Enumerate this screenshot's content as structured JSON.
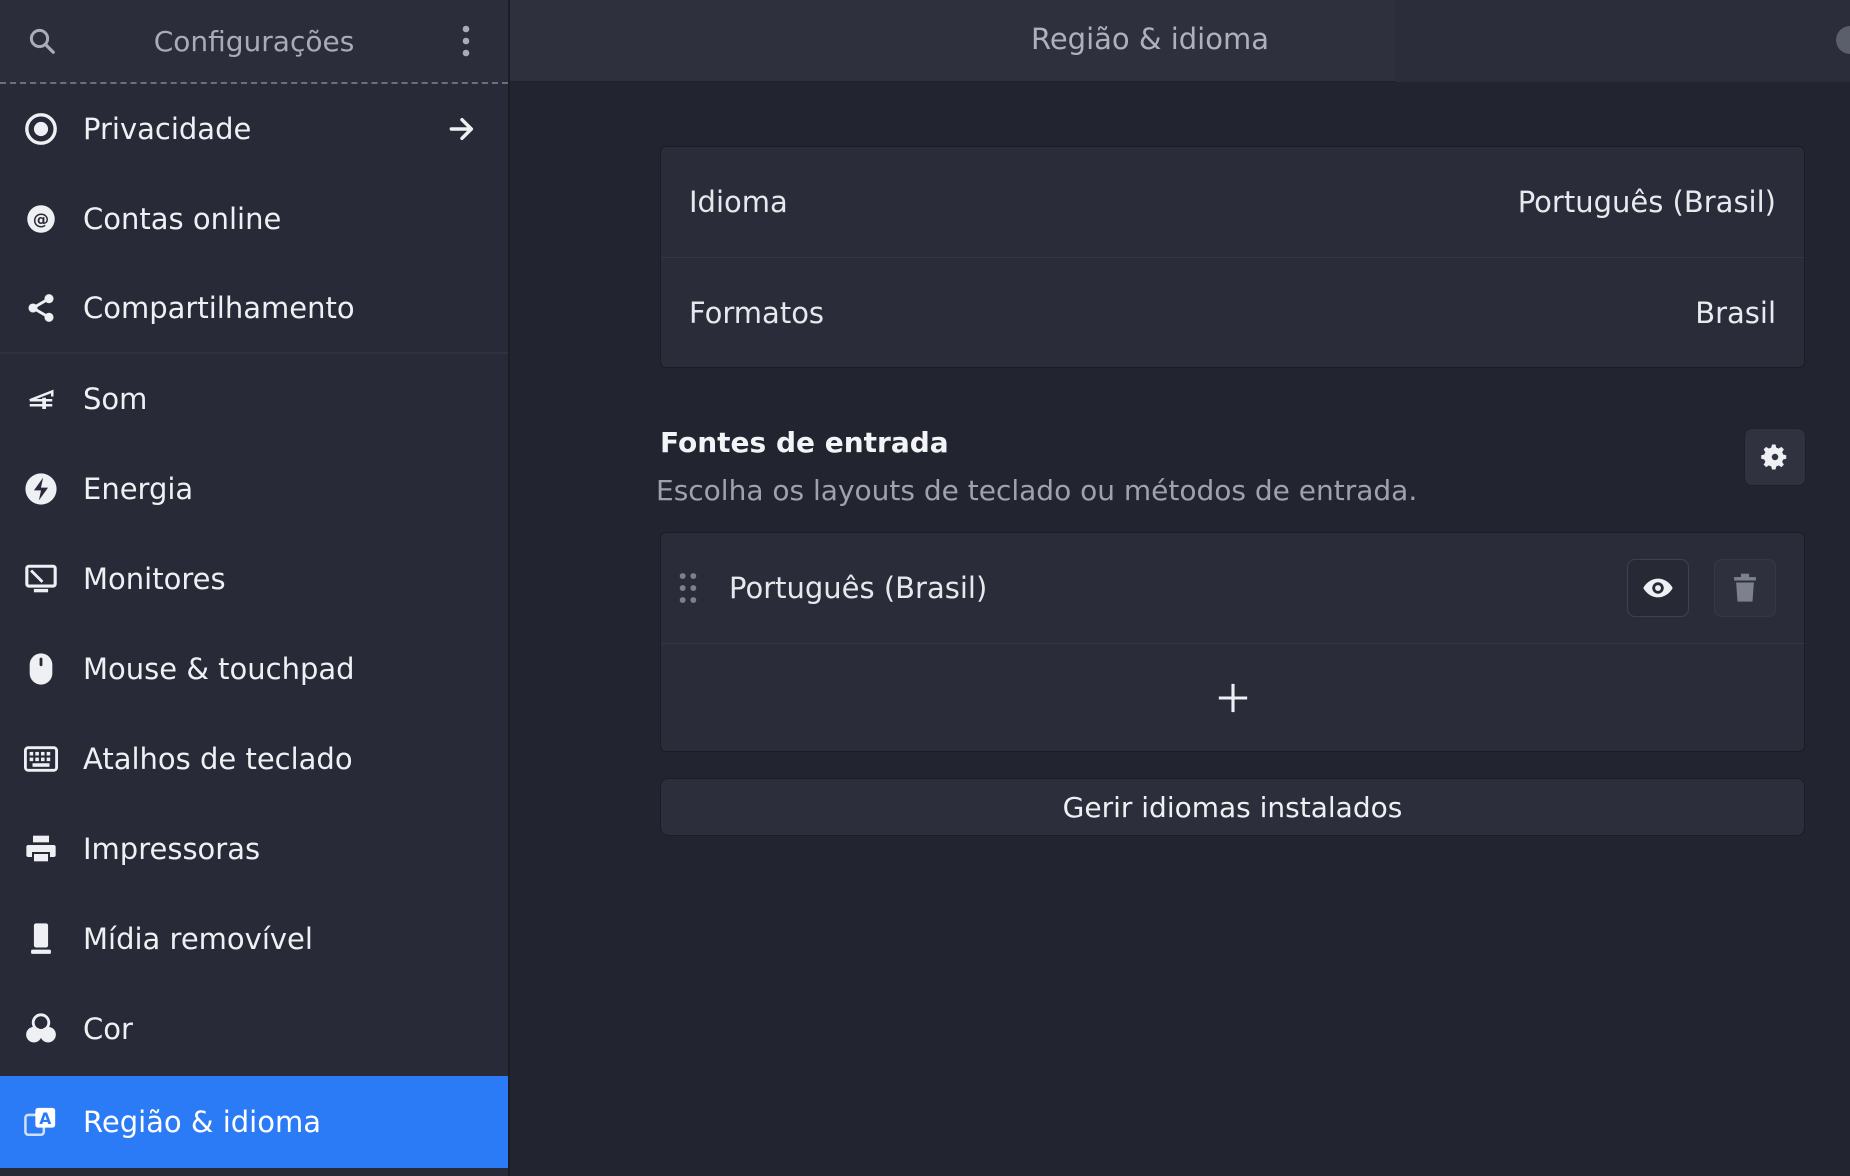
{
  "sidebar": {
    "title": "Configurações",
    "items": [
      {
        "label": "Privacidade",
        "icon": "privacy-icon"
      },
      {
        "label": "Contas online",
        "icon": "at-sign-icon"
      },
      {
        "label": "Compartilhamento",
        "icon": "share-icon"
      },
      {
        "label": "Som",
        "icon": "sound-icon"
      },
      {
        "label": "Energia",
        "icon": "power-icon"
      },
      {
        "label": "Monitores",
        "icon": "display-icon"
      },
      {
        "label": "Mouse & touchpad",
        "icon": "mouse-icon"
      },
      {
        "label": "Atalhos de teclado",
        "icon": "keyboard-icon"
      },
      {
        "label": "Impressoras",
        "icon": "printer-icon"
      },
      {
        "label": "Mídia removível",
        "icon": "removable-media-icon"
      },
      {
        "label": "Cor",
        "icon": "color-icon"
      },
      {
        "label": "Região & idioma",
        "icon": "region-language-icon",
        "active": true
      }
    ]
  },
  "header": {
    "title": "Região & idioma"
  },
  "language_card": {
    "rows": [
      {
        "label": "Idioma",
        "value": "Português (Brasil)"
      },
      {
        "label": "Formatos",
        "value": "Brasil"
      }
    ]
  },
  "input_sources": {
    "title": "Fontes de entrada",
    "subtitle": "Escolha os layouts de teclado ou métodos de entrada.",
    "items": [
      {
        "label": "Português (Brasil)"
      }
    ]
  },
  "manage_button": {
    "label": "Gerir idiomas instalados"
  },
  "colors": {
    "accent": "#2b7bf6",
    "sidebar_bg": "#282b37",
    "content_bg": "#22252f",
    "card_bg": "#2a2d39"
  }
}
